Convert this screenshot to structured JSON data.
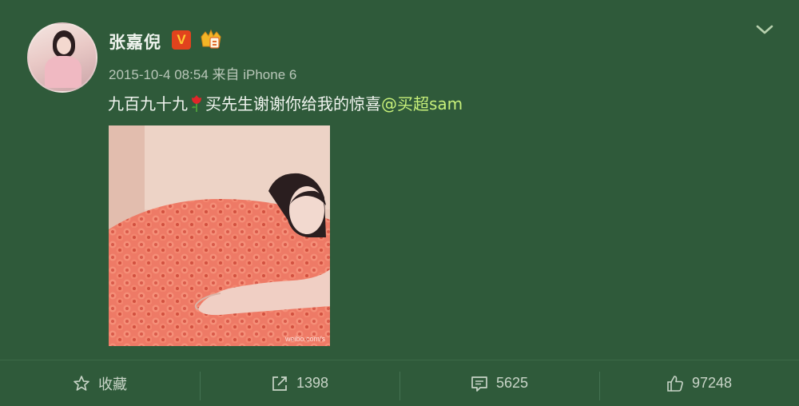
{
  "post": {
    "username": "张嘉倪",
    "verified_label": "V",
    "timestamp": "2015-10-4 08:54",
    "source": "来自 iPhone 6",
    "text_before": "九百九十九",
    "text_after": "买先生谢谢你给我的惊喜",
    "mention": "@买超sam",
    "photo_watermark": "weibo.com/s"
  },
  "icons": {
    "expand": "chevron-down-icon",
    "verified": "v-badge-icon",
    "member": "crown-member-icon",
    "favorite": "star-icon",
    "repost": "share-arrow-icon",
    "comment": "comment-icon",
    "like": "thumbs-up-icon"
  },
  "actions": {
    "favorite_label": "收藏",
    "repost_count": "1398",
    "comment_count": "5625",
    "like_count": "97248"
  },
  "colors": {
    "background": "#2f5a3a",
    "mention": "#c7f07a",
    "verified": "#e2431d"
  }
}
